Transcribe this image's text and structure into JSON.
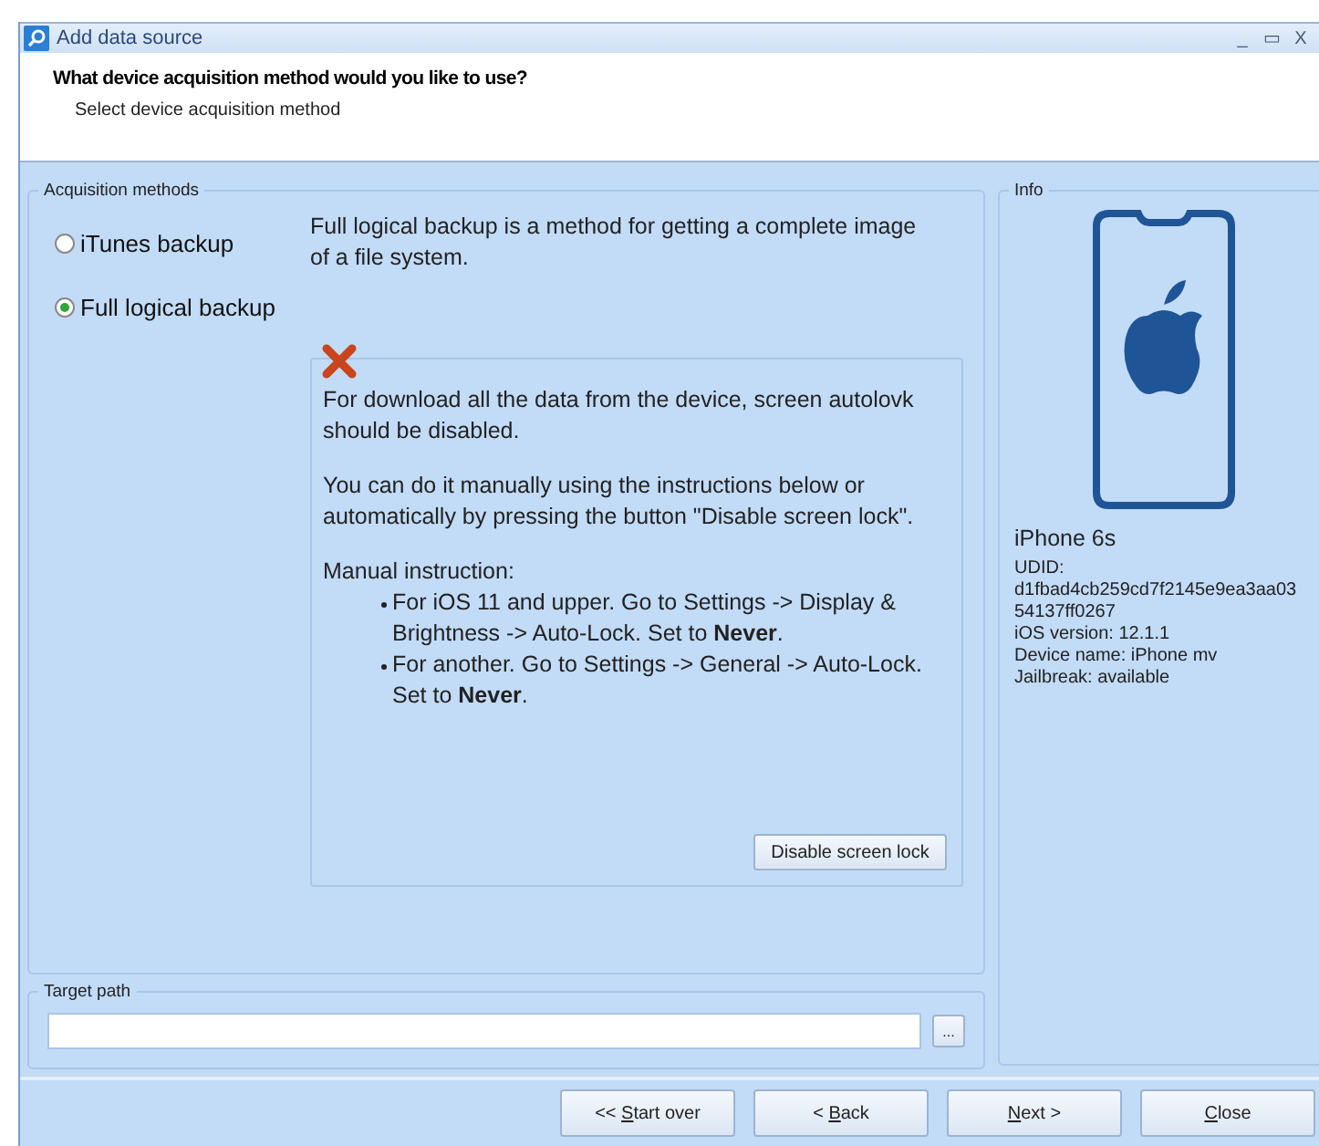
{
  "window": {
    "title": "Add data source",
    "controls": [
      "_",
      "▭",
      "X"
    ]
  },
  "header": {
    "title": "What device acquisition method would you like to use?",
    "subtitle": "Select device acquisition method"
  },
  "methods": {
    "title": "Acquisition methods",
    "options": [
      {
        "label": "iTunes backup",
        "selected": false
      },
      {
        "label": "Full logical backup",
        "selected": true
      }
    ],
    "description": "Full logical backup is a method for getting a complete image of a file system.",
    "warning": {
      "paragraphs": [
        "For download all the data from the device, screen autolovk should be disabled.",
        "You can do it manually using the instructions below or automatically by pressing the button \"Disable screen lock\"."
      ],
      "instruction_title": "Manual instruction:",
      "bullets": [
        "For iOS 11 and upper. Go to Settings -> Display & Brightness -> Auto-Lock. Set to **Never**.",
        "For another. Go to Settings -> General -> Auto-Lock. Set to **Never**."
      ],
      "button": "Disable screen lock"
    }
  },
  "target_path": {
    "title": "Target path",
    "browse": "..."
  },
  "info": {
    "title": "Info",
    "device": "iPhone 6s",
    "lines": [
      "UDID:",
      "d1fbad4cb259cd7f2145e9ea3aa03",
      "54137ff0267",
      "iOS version: 12.1.1",
      "Device name: iPhone mv",
      "Jailbreak: available"
    ]
  },
  "buttons": [
    {
      "before": "<< ",
      "key": "S",
      "after": "tart over"
    },
    {
      "before": "< ",
      "key": "B",
      "after": "ack"
    },
    {
      "key": "N",
      "after": "ext >"
    },
    {
      "key": "C",
      "after": "lose"
    }
  ]
}
